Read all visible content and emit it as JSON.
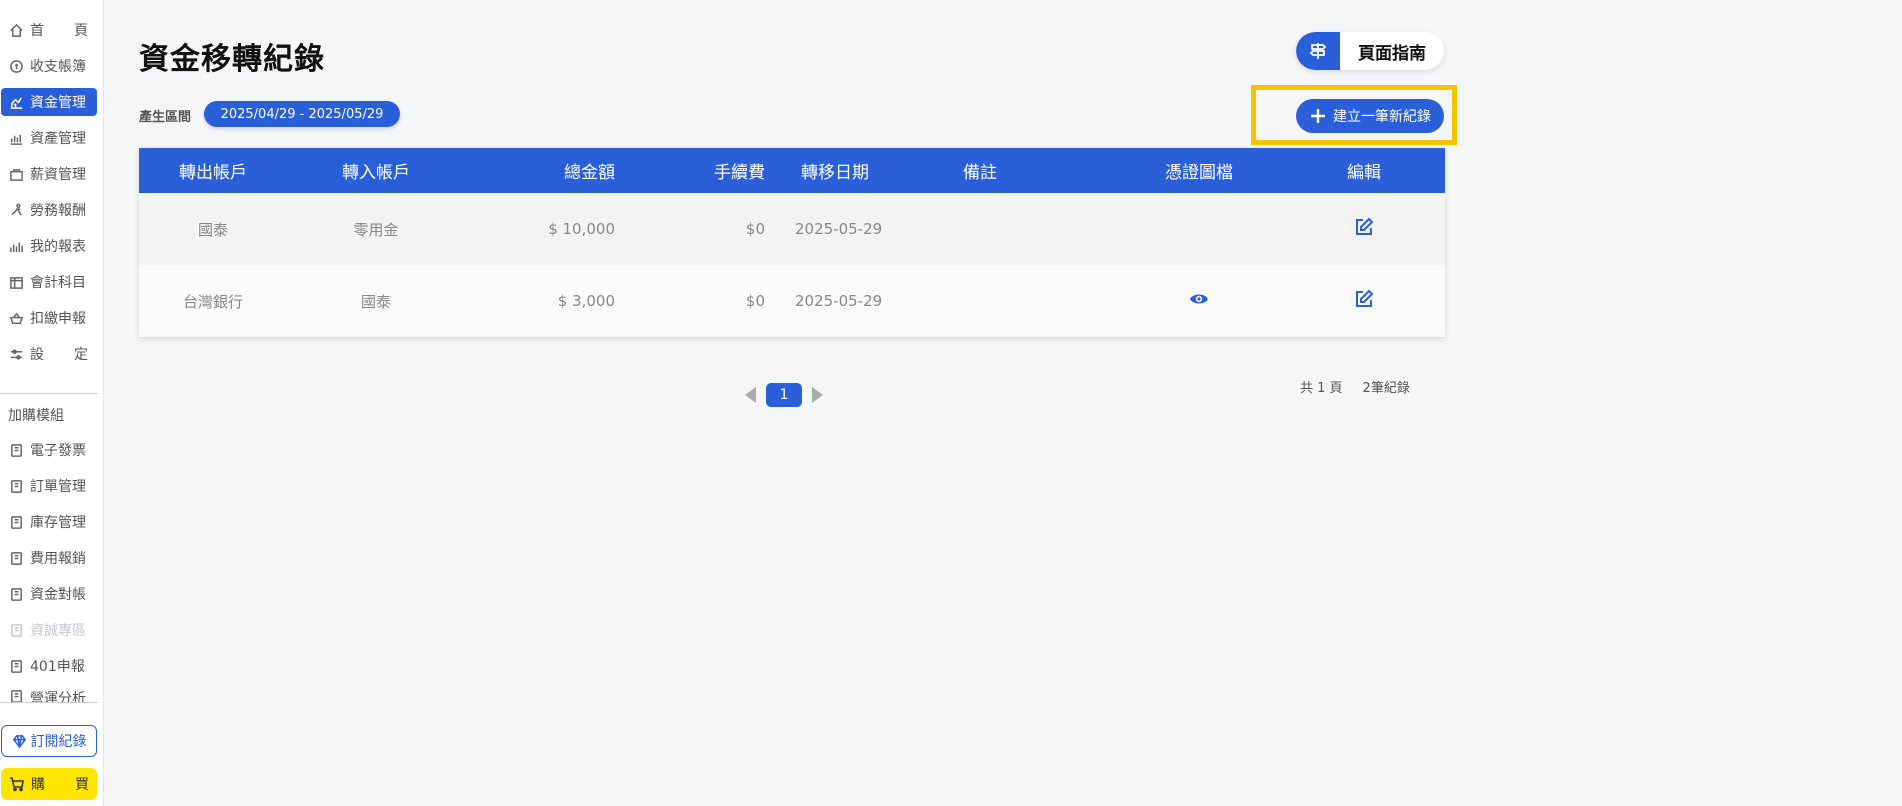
{
  "sidebar": {
    "items": [
      {
        "label": "首　頁",
        "icon": "home-icon"
      },
      {
        "label": "收支帳簿",
        "icon": "coin-icon"
      },
      {
        "label": "資金管理",
        "icon": "fund-icon"
      },
      {
        "label": "資產管理",
        "icon": "assets-icon"
      },
      {
        "label": "薪資管理",
        "icon": "salary-icon"
      },
      {
        "label": "勞務報酬",
        "icon": "labor-icon"
      },
      {
        "label": "我的報表",
        "icon": "report-icon"
      },
      {
        "label": "會計科目",
        "icon": "ledger-icon"
      },
      {
        "label": "扣繳申報",
        "icon": "tax-icon"
      },
      {
        "label": "設　定",
        "icon": "settings-icon"
      }
    ],
    "addon_title": "加購模組",
    "addons": [
      {
        "label": "電子發票"
      },
      {
        "label": "訂單管理"
      },
      {
        "label": "庫存管理"
      },
      {
        "label": "費用報銷"
      },
      {
        "label": "資金對帳"
      },
      {
        "label": "資誠專區"
      },
      {
        "label": "401申報"
      },
      {
        "label": "營運分析"
      }
    ],
    "subscribe_label": "訂閱紀錄",
    "buy_label": "購　買"
  },
  "page": {
    "title": "資金移轉紀錄",
    "guide_label": "頁面指南",
    "range_label": "產生區間",
    "range_value": "2025/04/29 - 2025/05/29",
    "create_label": "建立一筆新紀錄"
  },
  "table": {
    "headers": [
      "轉出帳戶",
      "轉入帳戶",
      "總金額",
      "手續費",
      "轉移日期",
      "備註",
      "憑證圖檔",
      "編輯"
    ],
    "rows": [
      {
        "from": "國泰",
        "to": "零用金",
        "total": "$ 10,000",
        "fee": "$0",
        "date": "2025-05-29",
        "note": "",
        "has_proof": false
      },
      {
        "from": "台灣銀行",
        "to": "國泰",
        "total": "$ 3,000",
        "fee": "$0",
        "date": "2025-05-29",
        "note": "",
        "has_proof": true
      }
    ]
  },
  "pagination": {
    "current": "1",
    "total_pages": "共 1 頁",
    "total_records": "2筆紀錄"
  },
  "colors": {
    "primary": "#2b5fd9",
    "highlight": "#f7c300",
    "buy": "#ffe600"
  }
}
